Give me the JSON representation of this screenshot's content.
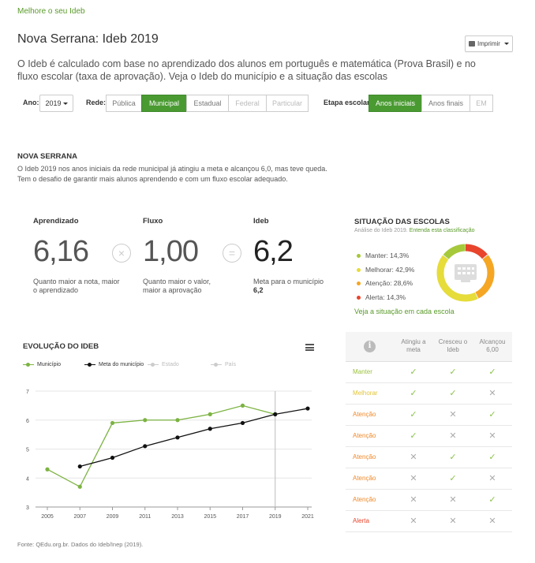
{
  "top_link": "Melhore o seu Ideb",
  "title": "Nova Serrana: Ideb 2019",
  "print_label": "Imprimir",
  "intro": "O Ideb é calculado com base no aprendizado dos alunos em português e matemática (Prova Brasil) e no fluxo escolar (taxa de aprovação). Veja o Ideb do município e a situação das escolas",
  "filters": {
    "year_label": "Ano:",
    "year_value": "2019",
    "rede_label": "Rede:",
    "rede": [
      "Pública",
      "Municipal",
      "Estadual",
      "Federal",
      "Particular"
    ],
    "etapa_label": "Etapa escolar:",
    "etapa": [
      "Anos iniciais",
      "Anos finais",
      "EM"
    ]
  },
  "city": {
    "heading": "NOVA SERRANA",
    "line1": "O Ideb 2019 nos anos iniciais da rede municipal já atingiu a meta e alcançou 6,0, mas teve queda.",
    "line2": "Tem o desafio de garantir mais alunos aprendendo e com um fluxo escolar adequado."
  },
  "metrics": {
    "aprendizado": {
      "label": "Aprendizado",
      "value": "6,16",
      "desc": "Quanto maior a nota, maior o aprendizado"
    },
    "fluxo": {
      "label": "Fluxo",
      "value": "1,00",
      "desc": "Quanto maior o valor, maior a aprovação"
    },
    "ideb": {
      "label": "Ideb",
      "value": "6,2",
      "desc": "Meta para o município",
      "meta": "6,2"
    },
    "times_symbol": "×",
    "equals_symbol": "="
  },
  "situacao": {
    "title": "SITUAÇÃO DAS ESCOLAS",
    "sub": "Análise do Ideb 2019.",
    "sub_link": "Entenda esta classificação",
    "items": [
      {
        "label": "Manter: 14,3%",
        "color": "#a5c93a",
        "pct": 14.3
      },
      {
        "label": "Melhorar: 42,9%",
        "color": "#e6dc3a",
        "pct": 42.9
      },
      {
        "label": "Atenção: 28,6%",
        "color": "#f5a623",
        "pct": 28.6
      },
      {
        "label": "Alerta: 14,3%",
        "color": "#e8452c",
        "pct": 14.3
      }
    ],
    "link": "Veja a situação em cada escola"
  },
  "chart_data": {
    "type": "line",
    "title": "EVOLUÇÃO DO IDEB",
    "x": [
      "2005",
      "2007",
      "2009",
      "2011",
      "2013",
      "2015",
      "2017",
      "2019",
      "2021"
    ],
    "ylim": [
      3,
      7
    ],
    "yticks": [
      "3",
      "4",
      "5",
      "6",
      "7"
    ],
    "highlight_x": "2019",
    "legend": [
      "Município",
      "Meta do município",
      "Estado",
      "País"
    ],
    "series": [
      {
        "name": "Município",
        "color": "#7cb342",
        "values": [
          4.3,
          3.7,
          5.9,
          6.0,
          6.0,
          6.2,
          6.5,
          6.2,
          null
        ]
      },
      {
        "name": "Meta do município",
        "color": "#111111",
        "values": [
          null,
          4.4,
          4.7,
          5.1,
          5.4,
          5.7,
          5.9,
          6.2,
          6.4
        ]
      }
    ]
  },
  "table": {
    "headers": [
      "Atingiu a meta",
      "Cresceu o Ideb",
      "Alcançou 6,00"
    ],
    "info_glyph": "i",
    "rows": [
      {
        "label": "Manter",
        "color": "#9bc13c",
        "marks": [
          true,
          true,
          true
        ]
      },
      {
        "label": "Melhorar",
        "color": "#e3c53a",
        "marks": [
          true,
          true,
          false
        ]
      },
      {
        "label": "Atenção",
        "color": "#f0892a",
        "marks": [
          true,
          false,
          true
        ]
      },
      {
        "label": "Atenção",
        "color": "#f0892a",
        "marks": [
          true,
          false,
          false
        ]
      },
      {
        "label": "Atenção",
        "color": "#f0892a",
        "marks": [
          false,
          true,
          true
        ]
      },
      {
        "label": "Atenção",
        "color": "#f0892a",
        "marks": [
          false,
          true,
          false
        ]
      },
      {
        "label": "Atenção",
        "color": "#f0892a",
        "marks": [
          false,
          false,
          true
        ]
      },
      {
        "label": "Alerta",
        "color": "#e8452c",
        "marks": [
          false,
          false,
          false
        ]
      }
    ]
  },
  "footer": "Fonte: QEdu.org.br. Dados do Ideb/Inep (2019)."
}
